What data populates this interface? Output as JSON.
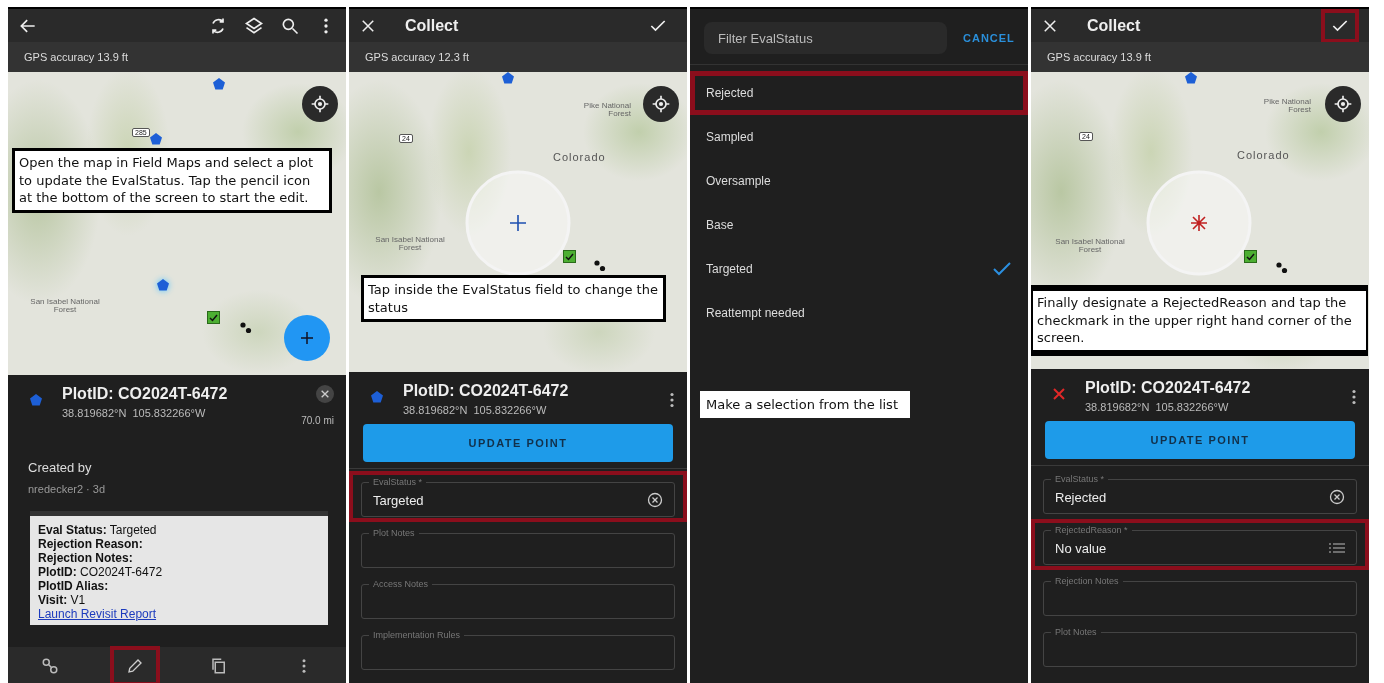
{
  "panels": [
    {
      "kind": "map_view",
      "gps": "GPS accuracy 13.9 ft",
      "map_labels": [
        "285",
        "San Isabel National Forest"
      ],
      "callout": "Open the map in Field Maps and select a plot to update the EvalStatus. Tap the pencil icon at the bottom of the screen to start the edit.",
      "feature": {
        "kind": "pentagon",
        "title": "PlotID: CO2024T-6472",
        "coords": "38.819682°N  105.832266°W",
        "distance": "70.0 mi"
      },
      "created_label": "Created by",
      "created_by": "nredecker2 · 3d",
      "popup_lines": [
        "**Eval Status:** Targeted",
        "**Rejection Reason:**",
        "**Rejection Notes:**",
        "**PlotID:** CO2024T-6472",
        "**PlotID Alias:**",
        "**Visit:** V1"
      ],
      "popup_link": "Launch Revisit Report",
      "bottom_tools": [
        {
          "kind": "link",
          "highlighted": false
        },
        {
          "kind": "edit",
          "highlighted": true
        },
        {
          "kind": "copy",
          "highlighted": false
        },
        {
          "kind": "more",
          "highlighted": false
        }
      ]
    },
    {
      "kind": "collect",
      "title": "Collect",
      "confirm_highlighted": false,
      "gps": "GPS accuracy 12.3 ft",
      "map_labels": [
        "24",
        "Pike National Forest",
        "Colorado",
        "San Isabel National Forest"
      ],
      "callout": "Tap inside the EvalStatus field to change the status",
      "feature": {
        "kind": "pentagon",
        "title": "PlotID: CO2024T-6472",
        "coords": "38.819682°N  105.832266°W"
      },
      "action": "UPDATE POINT",
      "fields": [
        {
          "kind": "clear",
          "label": "EvalStatus *",
          "value": "Targeted",
          "highlighted": true
        },
        {
          "kind": "text",
          "label": "Plot Notes",
          "highlighted": false
        },
        {
          "kind": "text",
          "label": "Access Notes",
          "highlighted": false
        },
        {
          "kind": "text",
          "label": "Implementation Rules",
          "highlighted": false
        }
      ]
    },
    {
      "kind": "picker",
      "filter_placeholder": "Filter EvalStatus",
      "cancel": "CANCEL",
      "options": [
        {
          "label": "Rejected",
          "selected": false,
          "highlighted": true
        },
        {
          "label": "Sampled",
          "selected": false,
          "highlighted": false
        },
        {
          "label": "Oversample",
          "selected": false,
          "highlighted": false
        },
        {
          "label": "Base",
          "selected": false,
          "highlighted": false
        },
        {
          "label": "Targeted",
          "selected": true,
          "highlighted": false
        },
        {
          "label": "Reattempt needed",
          "selected": false,
          "highlighted": false
        }
      ],
      "callout": "Make a selection from the list"
    },
    {
      "kind": "collect",
      "title": "Collect",
      "confirm_highlighted": true,
      "gps": "GPS accuracy 13.9 ft",
      "map_labels": [
        "24",
        "Pike National Forest",
        "Colorado",
        "San Isabel National Forest"
      ],
      "callout": "Finally designate a RejectedReason and tap the checkmark in the upper right hand corner of the screen.",
      "feature": {
        "kind": "cross",
        "title": "PlotID: CO2024T-6472",
        "coords": "38.819682°N  105.832266°W"
      },
      "action": "UPDATE POINT",
      "fields": [
        {
          "kind": "clear",
          "label": "EvalStatus *",
          "value": "Rejected",
          "highlighted": false
        },
        {
          "kind": "list",
          "label": "RejectedReason *",
          "value": "No value",
          "highlighted": true
        },
        {
          "kind": "text",
          "label": "Rejection Notes",
          "highlighted": false
        },
        {
          "kind": "text",
          "label": "Plot Notes",
          "highlighted": false
        }
      ]
    }
  ]
}
